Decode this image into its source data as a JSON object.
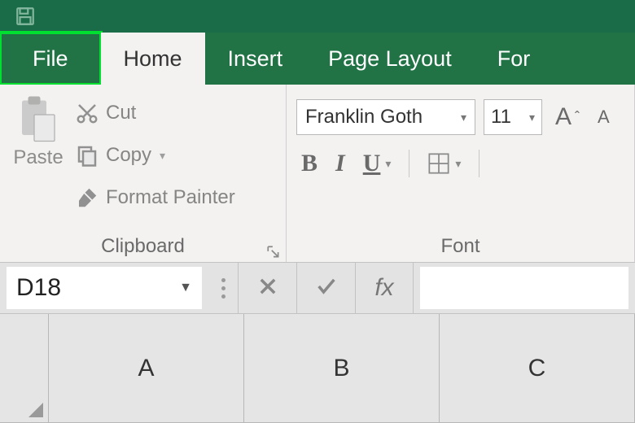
{
  "tabs": {
    "file": "File",
    "home": "Home",
    "insert": "Insert",
    "page_layout": "Page Layout",
    "formulas_partial": "For"
  },
  "clipboard": {
    "paste": "Paste",
    "cut": "Cut",
    "copy": "Copy",
    "format_painter": "Format Painter",
    "group_label": "Clipboard"
  },
  "font": {
    "name_value": "Franklin Goth",
    "size_value": "11",
    "bold": "B",
    "italic": "I",
    "underline": "U",
    "group_label": "Font"
  },
  "formula_bar": {
    "namebox_value": "D18",
    "fx_label": "fx"
  },
  "columns": [
    "A",
    "B",
    "C"
  ]
}
